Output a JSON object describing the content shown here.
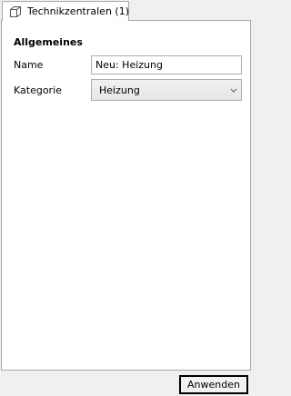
{
  "tab": {
    "label": "Technikzentralen (1)",
    "icon": "box-3d-icon"
  },
  "section": {
    "title": "Allgemeines"
  },
  "fields": {
    "name": {
      "label": "Name",
      "value": "Neu: Heizung"
    },
    "category": {
      "label": "Kategorie",
      "selected": "Heizung"
    }
  },
  "footer": {
    "apply_label": "Anwenden"
  }
}
